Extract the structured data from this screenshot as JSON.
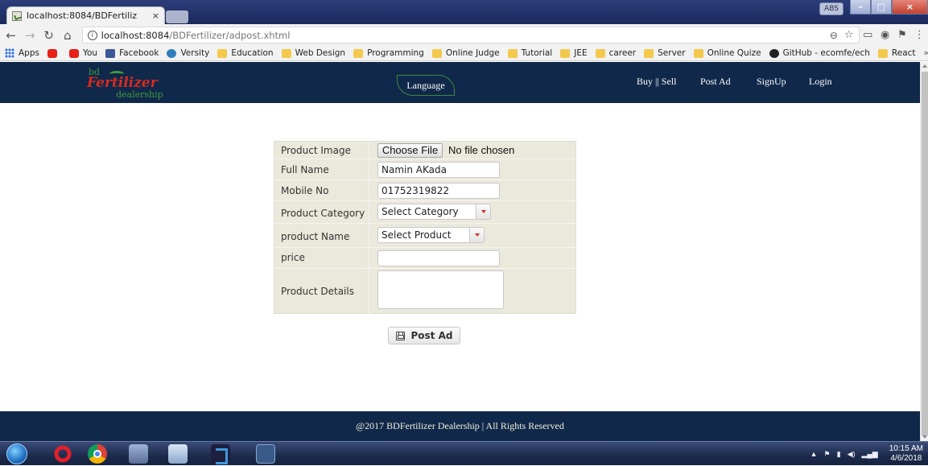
{
  "browser": {
    "tab_title": "localhost:8084/BDFertiliz",
    "tab_close": "×",
    "url_host": "localhost:8084",
    "url_path": "/BDFertilizer/adpost.xhtml",
    "abs_label": "ABS",
    "bookmarks": [
      {
        "label": "Apps",
        "icon": "apps-icon"
      },
      {
        "label": "",
        "icon": "youtube-icon"
      },
      {
        "label": "You",
        "icon": "youtube-icon"
      },
      {
        "label": "Facebook",
        "icon": "facebook-icon"
      },
      {
        "label": "Versity",
        "icon": "versity-icon"
      },
      {
        "label": "Education",
        "icon": "folder-icon"
      },
      {
        "label": "Web Design",
        "icon": "folder-icon"
      },
      {
        "label": "Programming",
        "icon": "folder-icon"
      },
      {
        "label": "Online Judge",
        "icon": "folder-icon"
      },
      {
        "label": "Tutorial",
        "icon": "folder-icon"
      },
      {
        "label": "JEE",
        "icon": "folder-icon"
      },
      {
        "label": "career",
        "icon": "folder-icon"
      },
      {
        "label": "Server",
        "icon": "folder-icon"
      },
      {
        "label": "Online Quize",
        "icon": "folder-icon"
      },
      {
        "label": "GitHub - ecomfe/ech",
        "icon": "github-icon"
      },
      {
        "label": "React",
        "icon": "folder-icon"
      }
    ],
    "bookmarks_more": "»"
  },
  "site": {
    "logo": {
      "bd": "bd",
      "brand": "Fertilizer",
      "dealer": "dealership"
    },
    "language_button": "Language",
    "nav": [
      {
        "label": "Buy || Sell"
      },
      {
        "label": "Post Ad"
      },
      {
        "label": "SignUp"
      },
      {
        "label": "Login"
      }
    ],
    "footer": "@2017 BDFertilizer Dealership | All Rights Reserved"
  },
  "form": {
    "product_image_label": "Product Image",
    "choose_file_button": "Choose File",
    "no_file_text": "No file chosen",
    "full_name_label": "Full Name",
    "full_name_value": "Namin AKada",
    "mobile_label": "Mobile No",
    "mobile_value": "01752319822",
    "category_label": "Product Category",
    "category_value": "Select Category",
    "product_name_label": "product Name",
    "product_name_value": "Select Product",
    "price_label": "price",
    "price_value": "",
    "details_label": "Product Details",
    "details_value": "",
    "post_button": "Post Ad"
  },
  "taskbar": {
    "time": "10:15 AM",
    "date": "4/6/2018",
    "tray_up": "▲"
  }
}
